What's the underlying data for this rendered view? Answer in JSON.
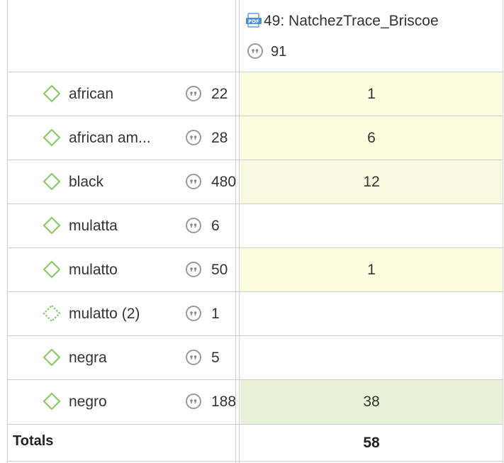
{
  "header": {
    "document_name": "49: NatchezTrace_Briscoe",
    "document_icon": "pdf-document-icon",
    "document_count": "91"
  },
  "rows": [
    {
      "code": "african",
      "count": "22",
      "value": "1",
      "icon_style": "solid"
    },
    {
      "code": "african am...",
      "count": "28",
      "value": "6",
      "icon_style": "solid"
    },
    {
      "code": "black",
      "count": "480",
      "value": "12",
      "icon_style": "solid"
    },
    {
      "code": "mulatta",
      "count": "6",
      "value": "",
      "icon_style": "solid"
    },
    {
      "code": "mulatto",
      "count": "50",
      "value": "1",
      "icon_style": "solid"
    },
    {
      "code": "mulatto (2)",
      "count": "1",
      "value": "",
      "icon_style": "dashed"
    },
    {
      "code": "negra",
      "count": "5",
      "value": "",
      "icon_style": "solid"
    },
    {
      "code": "negro",
      "count": "188",
      "value": "38",
      "icon_style": "solid"
    }
  ],
  "totals": {
    "label": "Totals",
    "value": "58"
  },
  "colors": {
    "code_icon": "#8cc96a",
    "cell_low": "#fdfde0",
    "cell_high": "#e9f2d9",
    "grid": "#d0d0d0"
  }
}
